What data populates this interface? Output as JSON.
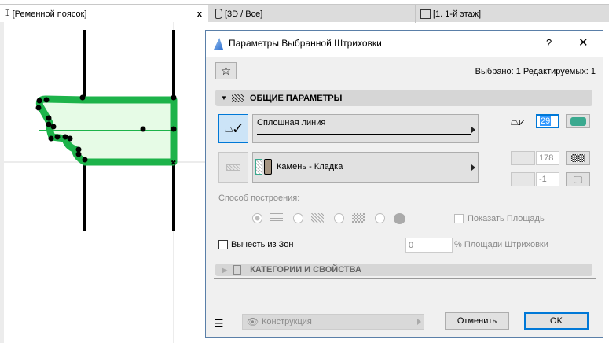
{
  "tabs": [
    {
      "label": "[Ременной поясок]",
      "icon": "section-icon",
      "active": true,
      "close": "x"
    },
    {
      "label": "[3D / Все]",
      "icon": "3d-icon"
    },
    {
      "label": "[1. 1-й этаж]",
      "icon": "floor-plan-icon"
    }
  ],
  "dialog": {
    "title": "Параметры Выбранной Штриховки",
    "help": "?",
    "close": "✕",
    "selection_info": "Выбрано: 1 Редактируемых: 1",
    "general_section": "ОБЩИЕ ПАРАМЕТРЫ",
    "line_type": "Сплошная линия",
    "pen_value": "29",
    "fill_name": "Камень - Кладка",
    "fill_pen": "178",
    "bg_pen": "-1",
    "construction_label": "Способ построения:",
    "show_area": "Показать Площадь",
    "subtract_zones": "Вычесть из Зон",
    "area_percent_value": "0",
    "area_percent_label": "% Площади Штриховки",
    "categories_section": "КАТЕГОРИИ И СВОЙСТВА",
    "layer": "Конструкция",
    "cancel": "Отменить",
    "ok": "OK"
  },
  "colors": {
    "accent": "#0078d7",
    "hatch_outline": "#1db34a",
    "hatch_fill": "#e6fbe6",
    "pen_color": "#3aa98f"
  }
}
